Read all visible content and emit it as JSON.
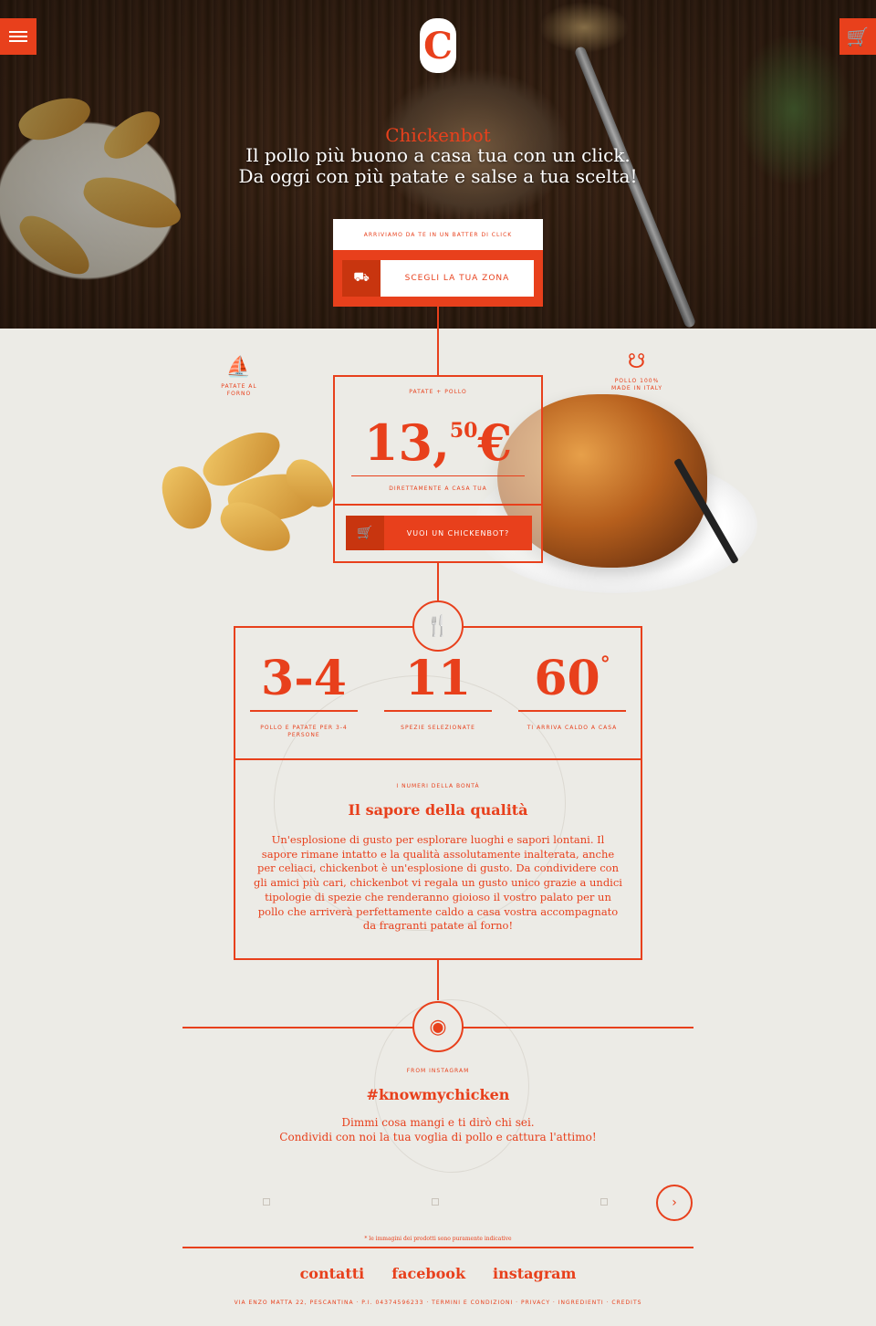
{
  "header": {
    "menu_icon": "hamburger-icon",
    "cart_icon": "cart-icon",
    "logo_letter": "C",
    "brand": "Chickenbot",
    "tagline_1": "Il pollo più buono a casa tua con un click.",
    "tagline_2": "Da oggi con più patate e salse a tua scelta!"
  },
  "zone": {
    "caption": "Arriviamo da te in un batter di click",
    "button_label": "Scegli la tua zona"
  },
  "features": {
    "left_label": "Patate al forno",
    "right_label": "Pollo 100% made in Italy"
  },
  "offer": {
    "label": "Patate + pollo",
    "price_main": "13,",
    "price_cents": "50",
    "currency": "€",
    "subtitle": "Direttamente a casa tua",
    "order_button": "Vuoi un chickenbot?"
  },
  "stats": [
    {
      "value": "3-4",
      "label": "Pollo e patate per 3-4 persone"
    },
    {
      "value": "11",
      "label": "Spezie selezionate"
    },
    {
      "value": "60",
      "label": "Ti arriva caldo a casa"
    }
  ],
  "stats_degree": "°",
  "quality": {
    "kicker": "I numeri della bontà",
    "title": "Il sapore della qualità",
    "text": "Un'esplosione di gusto per esplorare luoghi e sapori lontani. Il sapore rimane intatto e la qualità assolutamente inalterata, anche per celiaci, chickenbot è un'esplosione di gusto. Da condividere con gli amici più cari, chickenbot vi regala un gusto unico grazie a undici tipologie di spezie che renderanno gioioso il vostro palato per un pollo che arriverà perfettamente caldo a casa vostra accompagnato da fragranti patate al forno!"
  },
  "instagram": {
    "kicker": "From Instagram",
    "title": "#knowmychicken",
    "line_1": "Dimmi cosa mangi e ti dirò chi sei.",
    "line_2": "Condividi con noi la tua voglia di pollo e cattura l'attimo!",
    "next_label": "›"
  },
  "disclaimer": "* le immagini dei prodotti sono puramente indicative",
  "footer": {
    "links": [
      "contatti",
      "facebook",
      "instagram"
    ],
    "address": "VIA ENZO MATTA 22, PESCANTINA · P.I. 04374596233 · TERMINI E CONDIZIONI · PRIVACY · INGREDIENTI · CREDITS"
  },
  "colors": {
    "accent": "#e8401c",
    "background": "#ecebe6"
  }
}
